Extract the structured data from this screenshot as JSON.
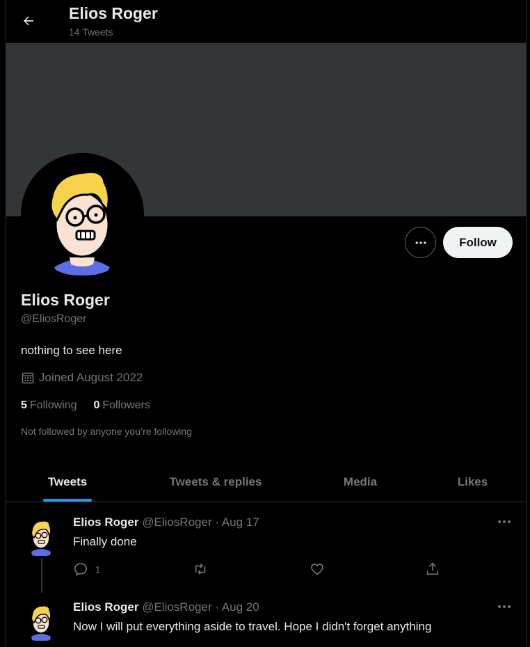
{
  "header": {
    "name": "Elios Roger",
    "tweet_count": "14 Tweets"
  },
  "profile": {
    "name": "Elios Roger",
    "handle": "@EliosRoger",
    "bio": "nothing to see here",
    "joined": "Joined August 2022",
    "following_count": "5",
    "following_label": "Following",
    "followers_count": "0",
    "followers_label": "Followers",
    "not_followed_note": "Not followed by anyone you’re following",
    "follow_label": "Follow"
  },
  "tabs": [
    {
      "label": "Tweets",
      "active": true
    },
    {
      "label": "Tweets & replies",
      "active": false
    },
    {
      "label": "Media",
      "active": false
    },
    {
      "label": "Likes",
      "active": false
    }
  ],
  "tweets": [
    {
      "name": "Elios Roger",
      "meta": "@EliosRoger · Aug 17",
      "text": "Finally done",
      "reply_count": "1"
    },
    {
      "name": "Elios Roger",
      "meta": "@EliosRoger · Aug 20",
      "text": "Now I will put everything aside to travel. Hope I didn't forget anything"
    }
  ],
  "colors": {
    "accent": "#1d9bf0",
    "banner": "#333639",
    "muted": "#71767b",
    "text": "#e7e9ea"
  }
}
